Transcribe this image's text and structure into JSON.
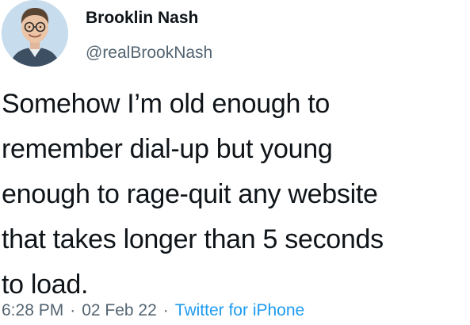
{
  "tweet": {
    "author": {
      "name": "Brooklin Nash",
      "handle": "@realBrookNash",
      "avatar_icon": "person-portrait-avatar"
    },
    "text_lines": [
      "Somehow I’m old enough to",
      "remember dial-up but young",
      "enough to rage-quit any website",
      "that takes longer than 5 seconds",
      "to load."
    ],
    "meta": {
      "time": "6:28 PM",
      "separator": "·",
      "date": "02 Feb 22",
      "source": "Twitter for iPhone"
    }
  },
  "colors": {
    "text_primary": "#0f1419",
    "text_secondary": "#536471",
    "link": "#1d9bf0",
    "background": "#ffffff"
  }
}
